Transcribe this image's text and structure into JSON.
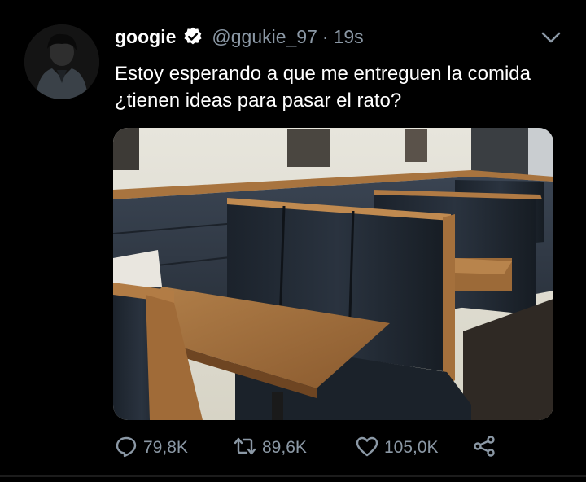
{
  "tweet": {
    "name": "googie",
    "handle": "@ggukie_97",
    "separator": "·",
    "time": "19s",
    "text": "Estoy esperando a que me entreguen la comida ¿tienen ideas para pasar el rato?",
    "media_alt": "restaurant booth",
    "counts": {
      "replies": "79,8K",
      "retweets": "89,6K",
      "likes": "105,0K"
    },
    "colors": {
      "background": "#000000",
      "secondary_text": "#8b98a5",
      "verified": "#ffffff"
    },
    "icons": [
      "verified-icon",
      "chevron-down-icon",
      "reply-icon",
      "retweet-icon",
      "like-icon",
      "share-icon"
    ]
  }
}
